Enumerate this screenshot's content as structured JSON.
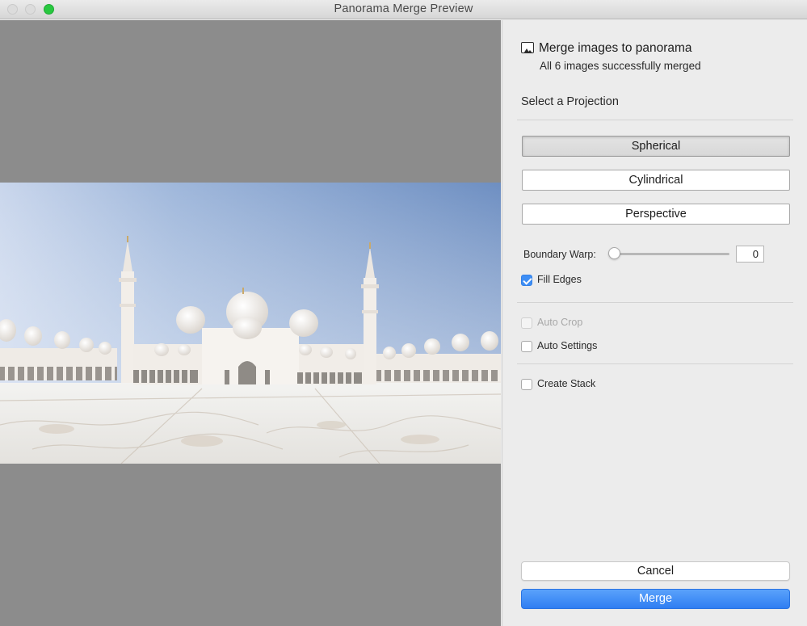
{
  "window": {
    "title": "Panorama Merge Preview",
    "controls": [
      "close-button",
      "minimize-button",
      "zoom-button"
    ]
  },
  "preview": {
    "background": "#8c8c8c",
    "image_subject": "panorama of white-domed mosque with minarets under blue sky"
  },
  "panel": {
    "header_title": "Merge images to panorama",
    "header_status": "All 6 images successfully merged",
    "projection_label": "Select a Projection",
    "projections": [
      {
        "label": "Spherical",
        "selected": true
      },
      {
        "label": "Cylindrical",
        "selected": false
      },
      {
        "label": "Perspective",
        "selected": false
      }
    ],
    "boundary_warp": {
      "label": "Boundary Warp:",
      "value": "0"
    },
    "fill_edges": {
      "label": "Fill Edges",
      "checked": true
    },
    "auto_crop": {
      "label": "Auto Crop",
      "checked": false,
      "disabled": true
    },
    "auto_settings": {
      "label": "Auto Settings",
      "checked": false
    },
    "create_stack": {
      "label": "Create Stack",
      "checked": false
    },
    "cancel_label": "Cancel",
    "merge_label": "Merge"
  },
  "colors": {
    "accent": "#3e8ef5",
    "merge_button": "#3b86f7",
    "zoom_traffic_light": "#28c840"
  }
}
